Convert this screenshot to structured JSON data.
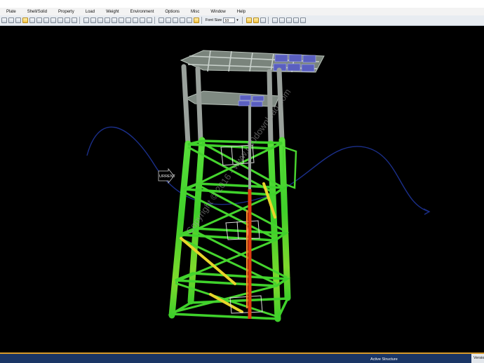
{
  "menu": [
    "Plate",
    "Shell/Solid",
    "Property",
    "Load",
    "Weight",
    "Environment",
    "Options",
    "Misc",
    "Window",
    "Help"
  ],
  "toolbar": {
    "font_label": "Font Size",
    "font_size": "10"
  },
  "viewport": {
    "current_label": "URRENT",
    "watermark": "Copyright © 2016 - www.p30download.com"
  },
  "status": {
    "structure": "Active Structure",
    "version": "Version"
  },
  "icons": [
    "undo-icon",
    "redo-icon",
    "select-icon",
    "zoom-icon",
    "pan-icon",
    "rotate-icon",
    "view-cube-icon",
    "dropdown-arrow-icon"
  ],
  "colors": {
    "structure_green": "#3fcf2a",
    "stress_yellow": "#e8d52a",
    "stress_red": "#e03a10",
    "current_wave": "#1b2f8a",
    "status_bar": "#1a3565"
  }
}
